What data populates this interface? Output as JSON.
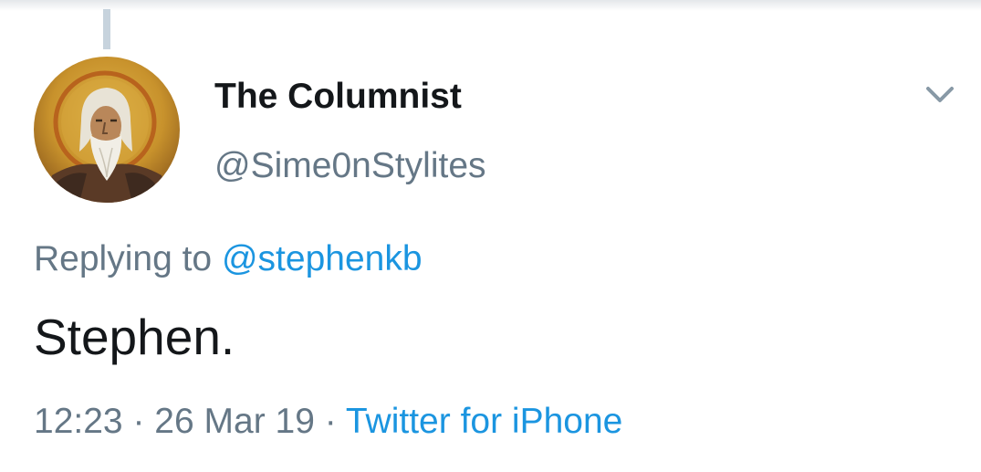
{
  "tweet": {
    "author": {
      "display_name": "The Columnist",
      "handle": "@Sime0nStylites"
    },
    "replying_to": {
      "label": "Replying to",
      "user": "@stephenkb"
    },
    "text": "Stephen.",
    "time": "12:23",
    "separator": "·",
    "date": "26 Mar 19",
    "source": "Twitter for iPhone"
  },
  "icons": {
    "menu": "chevron-down-icon",
    "avatar": "icon-portrait"
  },
  "colors": {
    "primary_text": "#14171a",
    "secondary_text": "#657786",
    "link": "#1b95e0",
    "thread_line": "#c7d3dd"
  }
}
